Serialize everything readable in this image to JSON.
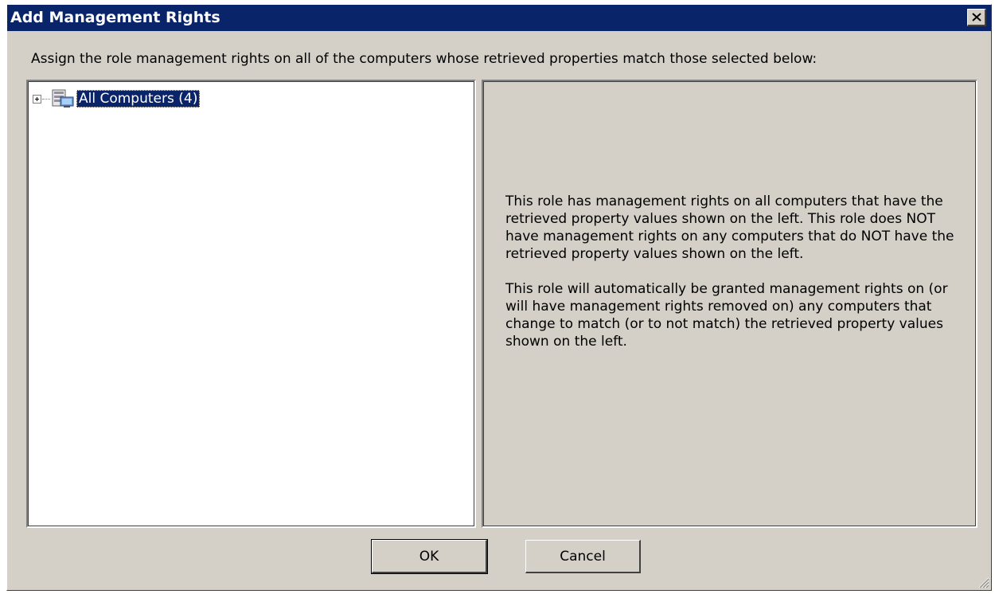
{
  "window": {
    "title": "Add Management Rights",
    "close_icon": "close-icon"
  },
  "instruction": "Assign the role management rights on all of the computers whose retrieved properties match those selected below:",
  "tree": {
    "nodes": [
      {
        "label": "All Computers (4)",
        "icon": "computers-group-icon",
        "expanded": false,
        "selected": true
      }
    ]
  },
  "info": {
    "paragraph1": "This role has management rights on all computers that have the retrieved property values shown on the left. This role does NOT have management rights on any computers that do NOT have the retrieved property values shown on the left.",
    "paragraph2": "This role will automatically be granted management rights on (or will have management rights removed on) any computers that change to match (or to not match) the retrieved property values shown on the left."
  },
  "buttons": {
    "ok": "OK",
    "cancel": "Cancel"
  },
  "colors": {
    "titlebar": "#0a246a",
    "dialog_background": "#d4d0c8",
    "selection": "#0a246a"
  }
}
